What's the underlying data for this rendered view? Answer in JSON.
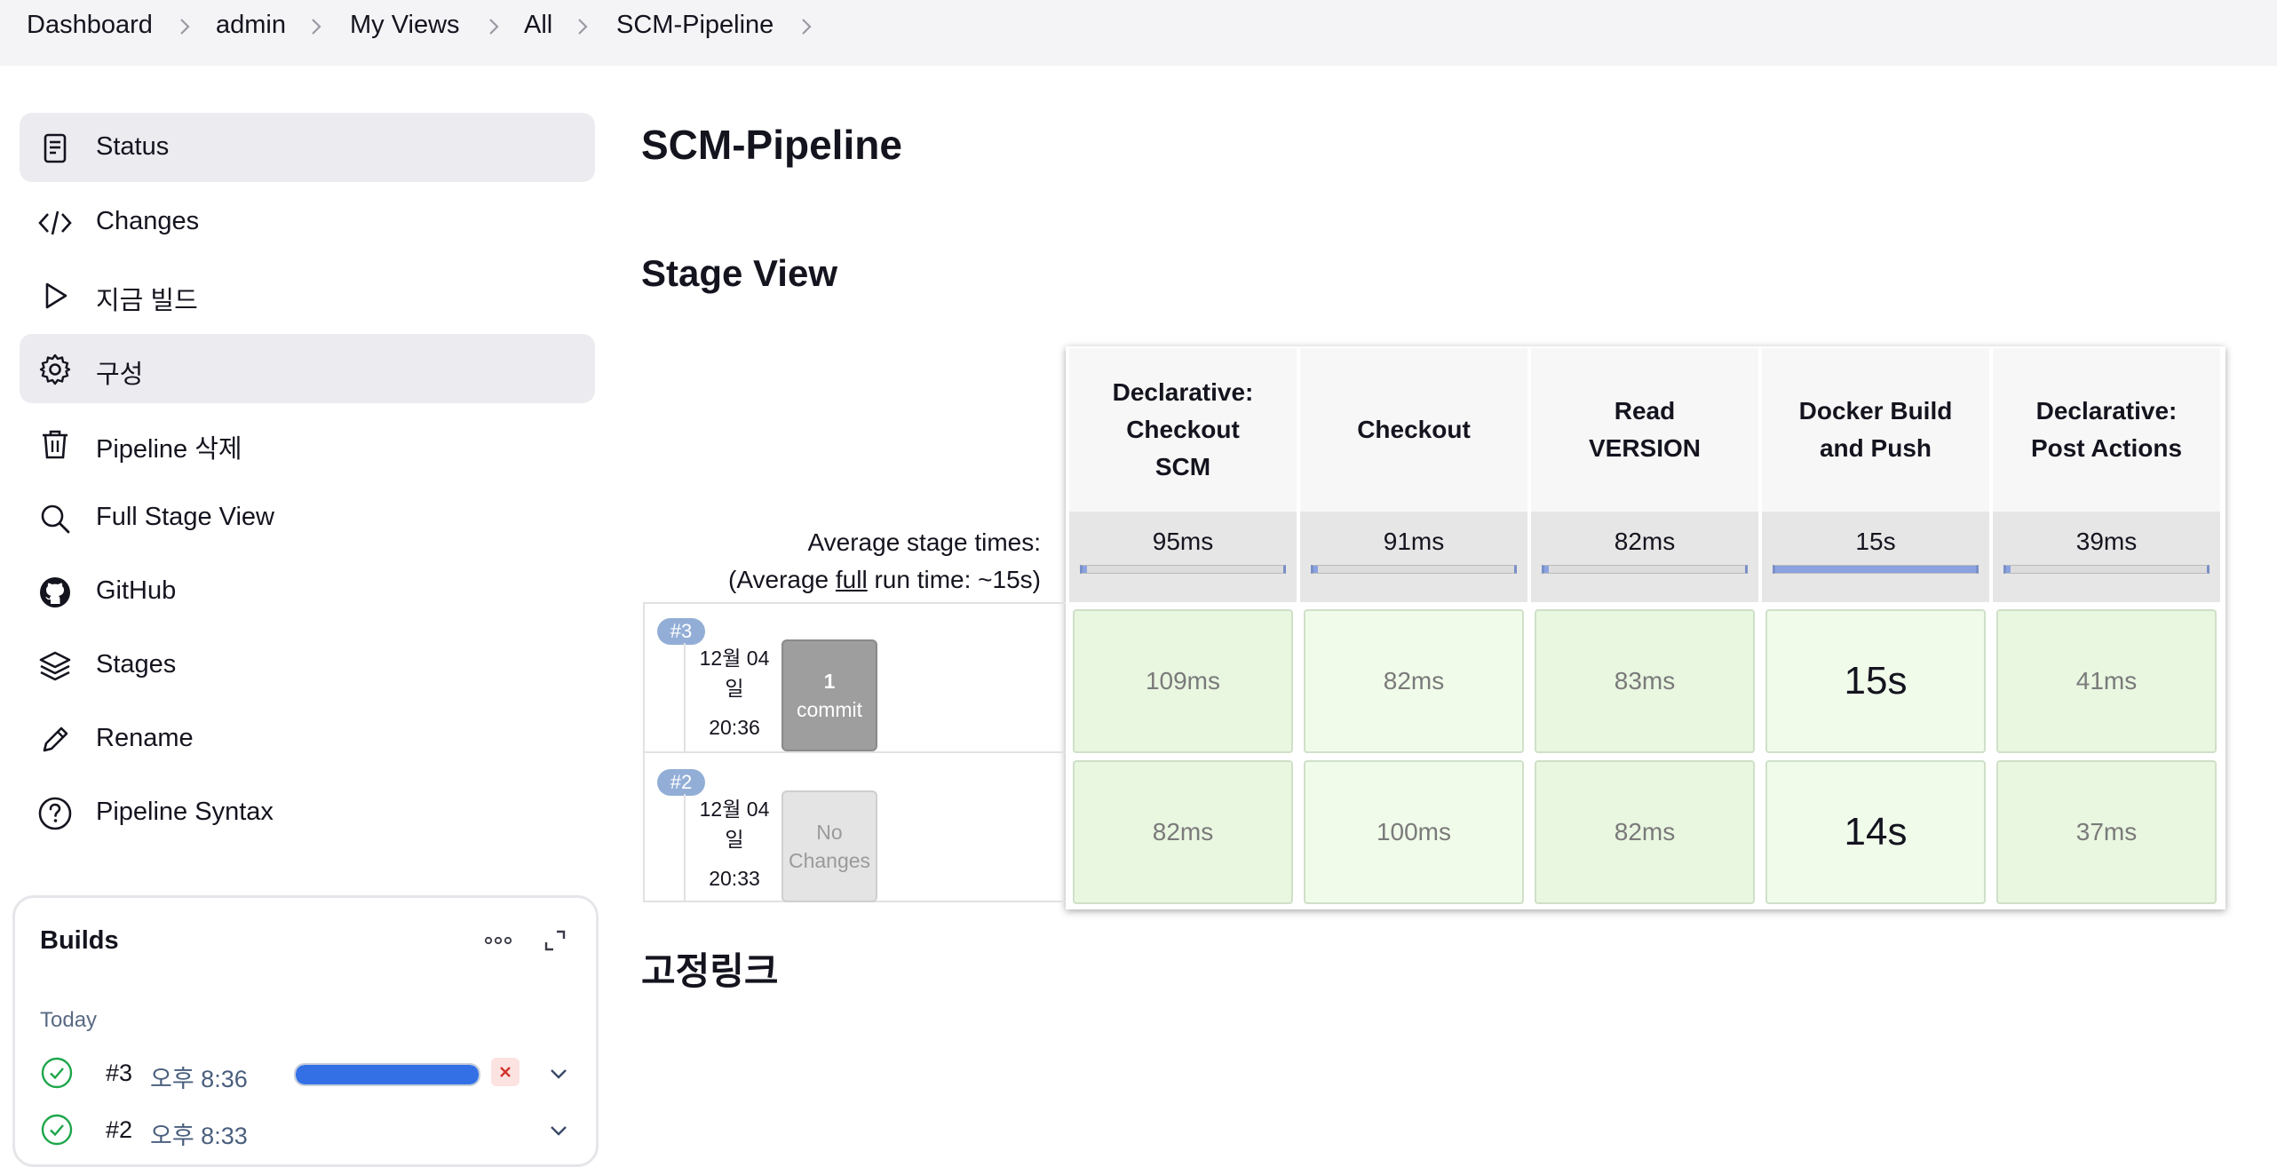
{
  "breadcrumb": {
    "items": [
      "Dashboard",
      "admin",
      "My Views",
      "All",
      "SCM-Pipeline"
    ]
  },
  "sidebar": {
    "items": [
      {
        "label": "Status",
        "icon": "document-icon",
        "active": true
      },
      {
        "label": "Changes",
        "icon": "code-icon",
        "active": false
      },
      {
        "label": "지금 빌드",
        "icon": "play-icon",
        "active": false
      },
      {
        "label": "구성",
        "icon": "gear-icon",
        "active": true
      },
      {
        "label": "Pipeline 삭제",
        "icon": "trash-icon",
        "active": false
      },
      {
        "label": "Full Stage View",
        "icon": "search-icon",
        "active": false
      },
      {
        "label": "GitHub",
        "icon": "github-icon",
        "active": false
      },
      {
        "label": "Stages",
        "icon": "layers-icon",
        "active": false
      },
      {
        "label": "Rename",
        "icon": "pencil-icon",
        "active": false
      },
      {
        "label": "Pipeline Syntax",
        "icon": "help-icon",
        "active": false
      }
    ]
  },
  "builds": {
    "title": "Builds",
    "group": "Today",
    "items": [
      {
        "number": "#3",
        "time": "오후 8:36",
        "progress": 1.0,
        "running": true
      },
      {
        "number": "#2",
        "time": "오후 8:33",
        "running": false
      }
    ]
  },
  "main": {
    "title": "SCM-Pipeline",
    "stage_view_title": "Stage View",
    "avg_label_line1": "Average stage times:",
    "avg_label_line2_pre": "(Average ",
    "avg_label_line2_u": "full",
    "avg_label_line2_post": " run time: ~15s)",
    "permalinks_title": "고정링크"
  },
  "stages": [
    {
      "name_lines": [
        "Declarative:",
        "Checkout",
        "SCM"
      ],
      "avg": "95ms",
      "avg_fraction": 0.02
    },
    {
      "name_lines": [
        "Checkout"
      ],
      "avg": "91ms",
      "avg_fraction": 0.02
    },
    {
      "name_lines": [
        "Read",
        "VERSION"
      ],
      "avg": "82ms",
      "avg_fraction": 0.02
    },
    {
      "name_lines": [
        "Docker Build",
        "and Push"
      ],
      "avg": "15s",
      "avg_fraction": 1.0
    },
    {
      "name_lines": [
        "Declarative:",
        "Post Actions"
      ],
      "avg": "39ms",
      "avg_fraction": 0.02
    }
  ],
  "runs": [
    {
      "badge": "#3",
      "date_line1": "12월 04",
      "date_line2": "일",
      "time": "20:36",
      "changes_line1": "1",
      "changes_line2": "commit",
      "changes_style": "dark",
      "cells": [
        "109ms",
        "82ms",
        "83ms",
        "15s",
        "41ms"
      ]
    },
    {
      "badge": "#2",
      "date_line1": "12월 04",
      "date_line2": "일",
      "time": "20:33",
      "changes_line1": "No",
      "changes_line2": "Changes",
      "changes_style": "light",
      "cells": [
        "82ms",
        "100ms",
        "82ms",
        "14s",
        "37ms"
      ]
    }
  ],
  "colors": {
    "accent": "#3370e6",
    "success": "#1ea64b",
    "cell_green_light": "#f1fbea",
    "cell_green": "#e9f6e0",
    "badge": "#93aed6"
  }
}
